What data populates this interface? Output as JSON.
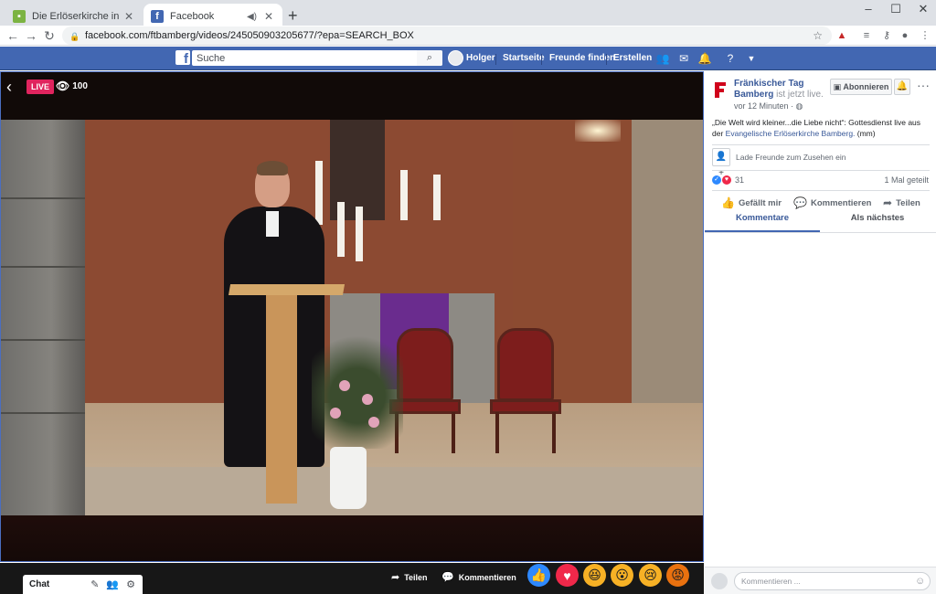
{
  "browser": {
    "tabs": [
      {
        "title": "Die Erlöserkirche in Bamberg ist live",
        "icon": "green-page-icon"
      },
      {
        "title": "Facebook",
        "icon": "facebook-f-icon"
      }
    ],
    "new_tab": "+",
    "url": "facebook.com/ftbamberg/videos/245050903205677/?epa=SEARCH_BOX",
    "window_controls": {
      "minimize": "–",
      "maximize": "☐",
      "close": "✕"
    }
  },
  "fb_header": {
    "search_placeholder": "Suche",
    "user": "Holger",
    "nav": [
      "Startseite",
      "Freunde finden",
      "Erstellen"
    ]
  },
  "video": {
    "live_label": "LIVE",
    "viewer_count": "100",
    "share_label": "Teilen",
    "comment_label": "Kommentieren"
  },
  "reactions": [
    {
      "name": "like",
      "glyph": "👍",
      "color": "#2e89ff"
    },
    {
      "name": "love",
      "glyph": "♥",
      "color": "#f0284a"
    },
    {
      "name": "haha",
      "glyph": "😆",
      "color": "#f7b125"
    },
    {
      "name": "wow",
      "glyph": "😮",
      "color": "#f7b125"
    },
    {
      "name": "sad",
      "glyph": "😢",
      "color": "#f7b125"
    },
    {
      "name": "angry",
      "glyph": "😡",
      "color": "#e9710f"
    }
  ],
  "chat": {
    "label": "Chat"
  },
  "panel": {
    "page_name": "Fränkischer Tag Bamberg",
    "status": "ist jetzt live.",
    "time_ago": "vor 12 Minuten ·",
    "subscribe_label": "Abonnieren",
    "description": "„Die Welt wird kleiner...die Liebe nicht“: Gottesdienst live aus der",
    "description_link": "Evangelische Erlöserkirche Bamberg.",
    "description_suffix": " (mm)",
    "invite_label": "Lade Freunde zum Zusehen ein",
    "reaction_count": "31",
    "shares": "1 Mal geteilt",
    "actions": [
      "Gefällt mir",
      "Kommentieren",
      "Teilen"
    ],
    "tabs": [
      "Kommentare",
      "Als nächstes"
    ],
    "comment_placeholder": "Kommentieren ..."
  },
  "colors": {
    "fb_blue": "#4267b2",
    "link": "#385898",
    "live_red": "#e0245e"
  }
}
